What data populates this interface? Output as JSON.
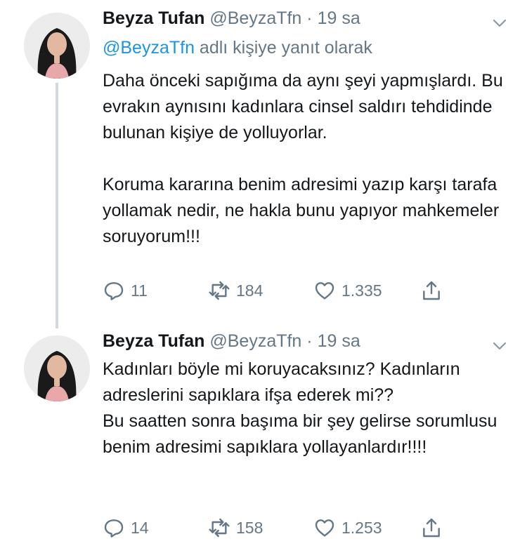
{
  "tweets": [
    {
      "name": "Beyza Tufan",
      "handle": "@BeyzaTfn",
      "dot": "·",
      "time": "19 sa",
      "reply_to": {
        "mention": "@BeyzaTfn",
        "suffix": " adlı kişiye yanıt olarak"
      },
      "paragraphs": [
        "Daha önceki sapığıma da aynı şeyi yapmışlardı. Bu evrakın aynısını kadınlara cinsel saldırı tehdidinde bulunan kişiye de yolluyorlar.",
        "Koruma kararına benim adresimi yazıp karşı tarafa yollamak nedir, ne hakla bunu yapıyor mahkemeler soruyorum!!!"
      ],
      "replies": "11",
      "retweets": "184",
      "likes": "1.335"
    },
    {
      "name": "Beyza Tufan",
      "handle": "@BeyzaTfn",
      "dot": "·",
      "time": "19 sa",
      "paragraphs": [
        "Kadınları böyle mi koruyacaksınız? Kadınların adreslerini sapıklara ifşa ederek mi??\nBu saatten sonra başıma bir şey gelirse sorumlusu benim adresimi sapıklara yollayanlardır!!!!"
      ],
      "replies": "14",
      "retweets": "158",
      "likes": "1.253"
    }
  ],
  "icons": {
    "reply": "reply-icon",
    "retweet": "retweet-icon",
    "like": "like-icon",
    "share": "share-icon",
    "caret": "chevron-down-icon"
  },
  "colors": {
    "accent": "#1b95e0",
    "muted": "#657786",
    "text": "#14171a",
    "thread": "#cfd9de"
  }
}
